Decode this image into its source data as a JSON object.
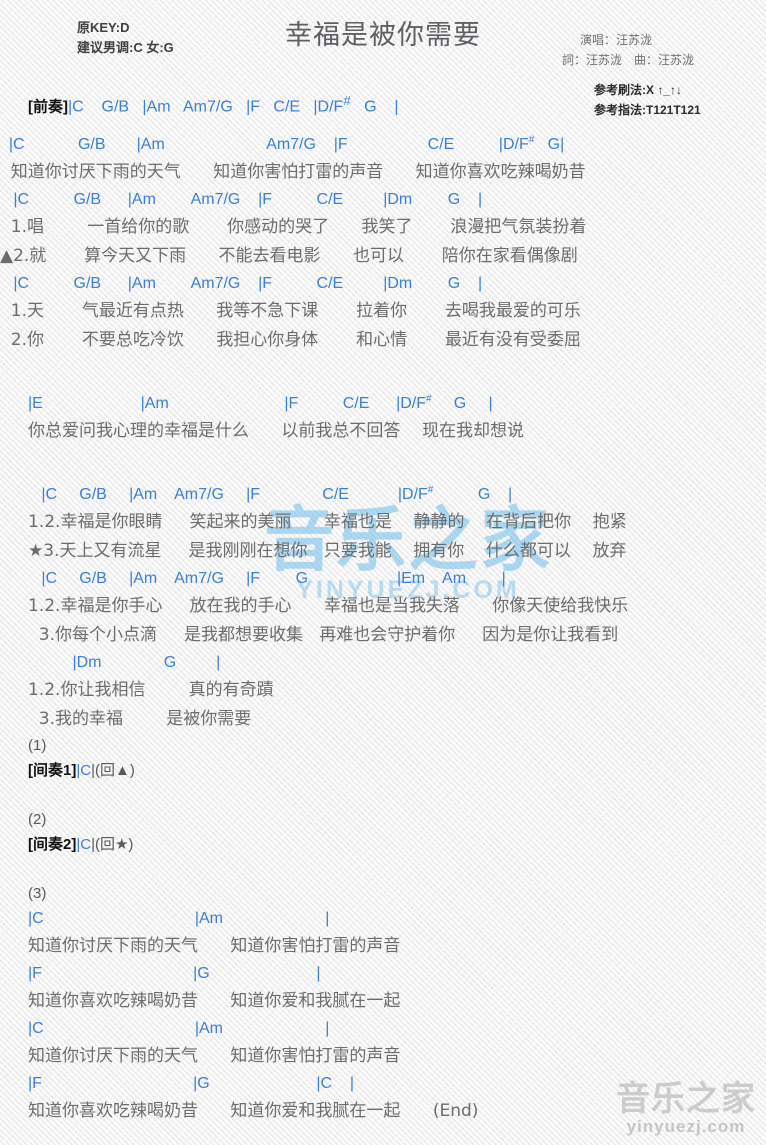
{
  "header": {
    "key_original": "原KEY:D",
    "key_suggest": "建议男调:C 女:G",
    "title": "幸福是被你需要",
    "performer": "演唱：汪苏泷",
    "writer_composer": "詞：汪苏泷　曲：汪苏泷",
    "strum": "参考刷法:X ↑_↑↓",
    "fingering": "参考指法:T121T121"
  },
  "intro": {
    "tag": "[前奏]",
    "chords": "|C    G/B   |Am   Am7/G   |F   C/E   |D/F"
  },
  "sections": {
    "verse1": {
      "chord_line_1": "  |C            G/B       |Am                       Am7/G    |F                  C/E          |D/F",
      "chord_line_1_tail": "   G|",
      "lyric_1": "  知道你讨厌下雨的天气      知道你害怕打雷的声音      知道你喜欢吃辣喝奶昔",
      "chord_line_2": "   |C          G/B      |Am        Am7/G    |F          C/E         |Dm        G    |",
      "lyric_2a": "  1.唱        一首给你的歌       你感动的哭了      我笑了       浪漫把气氛装扮着",
      "lyric_2b": "▲2.就       算今天又下雨      不能去看电影      也可以       陪你在家看偶像剧",
      "chord_line_3": "   |C          G/B      |Am        Am7/G    |F          C/E         |Dm        G    |",
      "lyric_3a": "  1.天       气最近有点热      我等不急下课       拉着你       去喝我最爱的可乐",
      "lyric_3b": "  2.你       不要总吃冷饮      我担心你身体       和心情       最近有没有受委屈"
    },
    "prechorus": {
      "chord_line": "|E                      |Am                          |F          C/E      |D/F",
      "chord_line_tail": "     G     |",
      "lyric": "你总爱问我心理的幸福是什么      以前我总不回答    现在我却想说"
    },
    "chorus": {
      "chord_line_1": "   |C     G/B     |Am    Am7/G     |F              C/E           |D/F",
      "chord_line_1_tail": "          G    |",
      "lyric_1a": "1.2.幸福是你眼睛     笑起来的美丽      幸福也是    静静的    在背后把你    抱紧",
      "lyric_1b": "★3.天上又有流星     是我刚刚在想你   只要我能    拥有你    什么都可以    放弃",
      "chord_line_2": "   |C     G/B     |Am    Am7/G     |F        G                    |Em    Am        |",
      "lyric_2a": "1.2.幸福是你手心     放在我的手心      幸福也是当我失落      你像天使给我快乐",
      "lyric_2b": "  3.你每个小点滴     是我都想要收集   再难也会守护着你     因为是你让我看到",
      "chord_line_3": "          |Dm              G         |",
      "lyric_3a": "1.2.你让我相信        真的有奇蹟",
      "lyric_3b": "  3.我的幸福        是被你需要"
    },
    "interlude1": {
      "number": "(1)",
      "tag": "[间奏1]",
      "chord": "|C",
      "repeat": "|(回▲)"
    },
    "interlude2": {
      "number": "(2)",
      "tag": "[间奏2]",
      "chord": "|C",
      "repeat": "|(回★)"
    },
    "outro": {
      "number": "(3)",
      "rows": [
        {
          "chords": "|C                                  |Am                       |",
          "lyric": "知道你讨厌下雨的天气      知道你害怕打雷的声音"
        },
        {
          "chords": "|F                                  |G                        |",
          "lyric": "知道你喜欢吃辣喝奶昔      知道你爱和我腻在一起"
        },
        {
          "chords": "|C                                  |Am                       |",
          "lyric": "知道你讨厌下雨的天气      知道你害怕打雷的声音"
        },
        {
          "chords": "|F                                  |G                        |C    |",
          "lyric": "知道你喜欢吃辣喝奶昔      知道你爱和我腻在一起      (End)"
        }
      ]
    }
  },
  "watermarks": {
    "center_cn": "音乐之家",
    "center_en": "YINYUEZJ.COM",
    "corner_cn": "音乐之家",
    "corner_en": "yinyuezj.com"
  },
  "colors": {
    "chord_blue": "#3c7fd0",
    "bar_blue": "#2a4f86",
    "lyric_gray": "#6b6c6e",
    "title_gray": "#5d5f63",
    "watermark_blue": "#6dbbeb"
  }
}
